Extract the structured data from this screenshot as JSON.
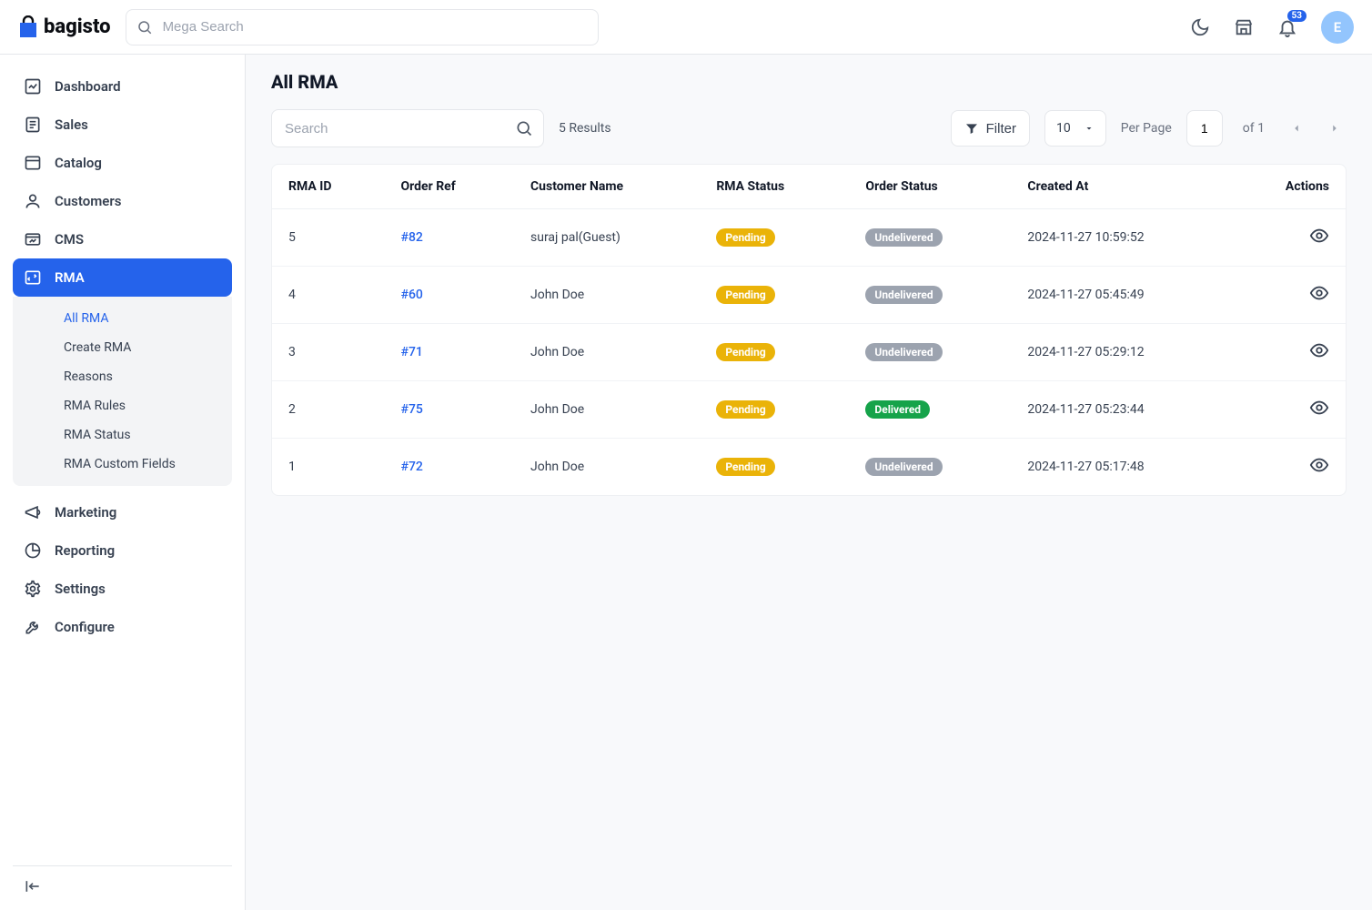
{
  "brand": {
    "name": "bagisto"
  },
  "header": {
    "search_placeholder": "Mega Search",
    "notification_count": "53",
    "avatar_initial": "E"
  },
  "sidebar": {
    "items": [
      {
        "label": "Dashboard",
        "icon": "dashboard"
      },
      {
        "label": "Sales",
        "icon": "sales"
      },
      {
        "label": "Catalog",
        "icon": "catalog"
      },
      {
        "label": "Customers",
        "icon": "customers"
      },
      {
        "label": "CMS",
        "icon": "cms"
      },
      {
        "label": "RMA",
        "icon": "rma",
        "active": true,
        "children": [
          {
            "label": "All RMA",
            "active": true
          },
          {
            "label": "Create RMA"
          },
          {
            "label": "Reasons"
          },
          {
            "label": "RMA Rules"
          },
          {
            "label": "RMA Status"
          },
          {
            "label": "RMA Custom Fields"
          }
        ]
      },
      {
        "label": "Marketing",
        "icon": "marketing"
      },
      {
        "label": "Reporting",
        "icon": "reporting"
      },
      {
        "label": "Settings",
        "icon": "settings"
      },
      {
        "label": "Configure",
        "icon": "configure"
      }
    ]
  },
  "page": {
    "title": "All RMA"
  },
  "toolbar": {
    "search_placeholder": "Search",
    "results_text": "5 Results",
    "filter_label": "Filter",
    "page_size": "10",
    "per_page_label": "Per Page",
    "current_page": "1",
    "total_pages": "1",
    "of_label": "of"
  },
  "table": {
    "columns": [
      "RMA ID",
      "Order Ref",
      "Customer Name",
      "RMA Status",
      "Order Status",
      "Created At",
      "Actions"
    ],
    "rows": [
      {
        "rma_id": "5",
        "order_ref": "#82",
        "customer": "suraj pal(Guest)",
        "rma_status": "Pending",
        "rma_status_class": "pending",
        "order_status": "Undelivered",
        "order_status_class": "undelivered",
        "created_at": "2024-11-27 10:59:52"
      },
      {
        "rma_id": "4",
        "order_ref": "#60",
        "customer": "John Doe",
        "rma_status": "Pending",
        "rma_status_class": "pending",
        "order_status": "Undelivered",
        "order_status_class": "undelivered",
        "created_at": "2024-11-27 05:45:49"
      },
      {
        "rma_id": "3",
        "order_ref": "#71",
        "customer": "John Doe",
        "rma_status": "Pending",
        "rma_status_class": "pending",
        "order_status": "Undelivered",
        "order_status_class": "undelivered",
        "created_at": "2024-11-27 05:29:12"
      },
      {
        "rma_id": "2",
        "order_ref": "#75",
        "customer": "John Doe",
        "rma_status": "Pending",
        "rma_status_class": "pending",
        "order_status": "Delivered",
        "order_status_class": "delivered",
        "created_at": "2024-11-27 05:23:44"
      },
      {
        "rma_id": "1",
        "order_ref": "#72",
        "customer": "John Doe",
        "rma_status": "Pending",
        "rma_status_class": "pending",
        "order_status": "Undelivered",
        "order_status_class": "undelivered",
        "created_at": "2024-11-27 05:17:48"
      }
    ]
  },
  "icons": {
    "dashboard": "<svg width='20' height='20' viewBox='0 0 24 24' fill='none' stroke='currentColor' stroke-width='2'><rect x='3' y='3' width='18' height='18' rx='2'/><path d='M7 14l3-3 3 3 4-5'/></svg>",
    "sales": "<svg width='20' height='20' viewBox='0 0 24 24' fill='none' stroke='currentColor' stroke-width='2'><rect x='4' y='3' width='16' height='18' rx='2'/><path d='M8 8h8M8 12h8M8 16h5'/></svg>",
    "catalog": "<svg width='20' height='20' viewBox='0 0 24 24' fill='none' stroke='currentColor' stroke-width='2'><rect x='3' y='4' width='18' height='16' rx='2'/><path d='M3 9h18'/></svg>",
    "customers": "<svg width='20' height='20' viewBox='0 0 24 24' fill='none' stroke='currentColor' stroke-width='2'><circle cx='12' cy='8' r='4'/><path d='M4 21c0-4 4-6 8-6s8 2 8 6'/></svg>",
    "cms": "<svg width='20' height='20' viewBox='0 0 24 24' fill='none' stroke='currentColor' stroke-width='2'><rect x='3' y='5' width='18' height='14' rx='2'/><path d='M3 9h18M8 16l3-3 2 2 3-3'/></svg>",
    "rma": "<svg width='20' height='20' viewBox='0 0 24 24' fill='none' stroke='currentColor' stroke-width='2'><rect x='3' y='4' width='18' height='16' rx='2'/><path d='M8 16l-2-2 2-2M14 8l2 2-2 2'/></svg>",
    "marketing": "<svg width='20' height='20' viewBox='0 0 24 24' fill='none' stroke='currentColor' stroke-width='2'><path d='M3 11l15-6v14L3 13z'/><path d='M18 9a3 3 0 010 6'/></svg>",
    "reporting": "<svg width='20' height='20' viewBox='0 0 24 24' fill='none' stroke='currentColor' stroke-width='2'><circle cx='12' cy='12' r='9'/><path d='M12 3v9h9'/></svg>",
    "settings": "<svg width='20' height='20' viewBox='0 0 24 24' fill='none' stroke='currentColor' stroke-width='2'><circle cx='12' cy='12' r='3'/><path d='M19 12a7 7 0 00-.2-1.7l2-1.5-2-3.4-2.3 1a7 7 0 00-2.9-1.7L13 2h-2l-.6 2.7A7 7 0 007.5 6.4l-2.3-1-2 3.4 2 1.5A7 7 0 005 12c0 .6.1 1.1.2 1.7l-2 1.5 2 3.4 2.3-1a7 7 0 002.9 1.7L11 22h2l.6-2.7a7 7 0 002.9-1.7l2.3 1 2-3.4-2-1.5c.1-.6.2-1.1.2-1.7z'/></svg>",
    "configure": "<svg width='20' height='20' viewBox='0 0 24 24' fill='none' stroke='currentColor' stroke-width='2'><path d='M14.7 6.3a4 4 0 00-5.4 5.4L4 17v3h3l5.3-5.3a4 4 0 005.4-5.4L15 12l-3-3 2.7-2.7z'/></svg>"
  }
}
